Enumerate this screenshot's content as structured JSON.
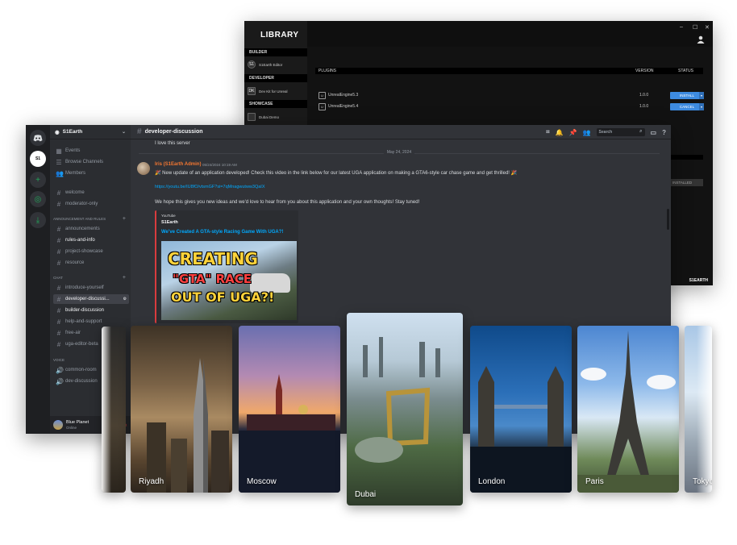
{
  "library": {
    "title": "LIBRARY",
    "window_controls": [
      "–",
      "☐",
      "✕"
    ],
    "sections": [
      {
        "header": "BUILDER",
        "items": [
          {
            "icon": "S1",
            "label": "S1Earth Editor"
          }
        ]
      },
      {
        "header": "DEVELOPER",
        "items": [
          {
            "icon": "DK",
            "label": "Dev Kit for Unreal"
          }
        ]
      },
      {
        "header": "SHOWCASE",
        "items": [
          {
            "icon": "",
            "label": "Dubai Demo"
          }
        ]
      }
    ],
    "table_headers": {
      "plugins": "PLUGINS",
      "version": "VERSION",
      "status": "STATUS"
    },
    "plugins": [
      {
        "name": "UnrealEngine5.3",
        "version": "1.0.0",
        "action": "INSTALL"
      },
      {
        "name": "UnrealEngine5.4",
        "version": "1.0.0",
        "action": "CANCEL"
      }
    ],
    "installed_label": "INSTALLED",
    "footer_brand": "S1EARTH"
  },
  "discord": {
    "server_name": "S1Earth",
    "top_items": [
      {
        "icon": "calendar-icon",
        "label": "Events"
      },
      {
        "icon": "browse-icon",
        "label": "Browse Channels"
      },
      {
        "icon": "members-icon",
        "label": "Members"
      }
    ],
    "channels_top": [
      "welcome",
      "moderator-only"
    ],
    "cat1": "ANNOUNCEMENT AND RULES",
    "channels_cat1": [
      "announcements",
      "rules-and-info",
      "project-showcase",
      "resource"
    ],
    "cat2": "CHAT",
    "channels_cat2": [
      "introduce-yourself",
      "developer-discussi...",
      "builder-discussion",
      "help-and-support",
      "free-air",
      "uga-editor-beta"
    ],
    "cat3": "VOICE",
    "voice_channels": [
      "common-room",
      "dev-discussion"
    ],
    "user": {
      "name": "Blue Planet",
      "status": "Online"
    },
    "channel_title": "developer-discussion",
    "search_placeholder": "Search",
    "prev_message": "I love this server",
    "date_divider": "May 24, 2024",
    "message": {
      "author": "Iris (S1Earth Admin)",
      "timestamp": "05/24/2024 10:19 AM",
      "line1": "New update of an application developed! Check this video in the link below for our latest UGA application on making a GTA6-style car chase game and get thrilled!",
      "link": "https://youtu.be/IU8fO/vtsmGF?si=7qMnagwutww3QaIX",
      "line2": "We hope this gives you new ideas and we'd love to hear from you about this application and your own thoughts! Stay tuned!"
    },
    "embed": {
      "provider": "YouTube",
      "channel": "S1Earth",
      "title": "We've Created A GTA-style Racing Game With UGA?!",
      "thumb_line1": "CREATING",
      "thumb_line2": "\"GTA\" RACE",
      "thumb_line3": "OUT OF UGA?!"
    }
  },
  "cities": [
    "Riyadh",
    "Moscow",
    "Dubai",
    "London",
    "Paris",
    "Tokyo"
  ]
}
